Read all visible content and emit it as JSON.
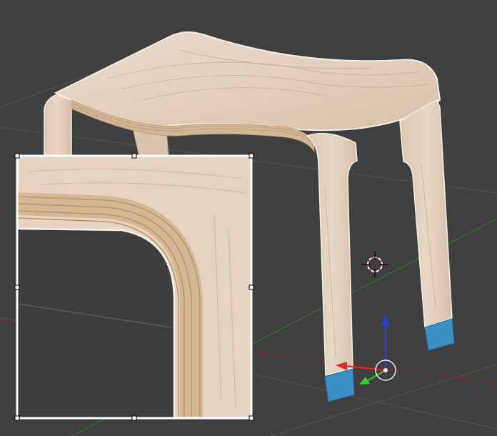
{
  "viewport": {
    "background": "#3f3f3f",
    "grid_color": "#5b5b5b",
    "x_axis_color": "#8a2323",
    "y_axis_color": "#2c7a2c"
  },
  "object": {
    "name": "stool",
    "wood_light": "#e8d6c6",
    "wood_mid": "#d9c2ad",
    "wood_edge": "#c9ae8f",
    "grain": "#b89a80",
    "foot_color": "#3a8fc4",
    "foot_dark": "#2a6f9c",
    "outline": "#f4efe9"
  },
  "gizmo": {
    "z_color": "#2a3fe0",
    "x_color": "#e02a2a",
    "y_color": "#2ad12a",
    "pivot_color": "#f0f0f0"
  },
  "cursor": {
    "ring_color": "#e04545",
    "cross_color": "#111111"
  },
  "zoom_inset": {
    "border_color": "#ffffff",
    "handle_fill": "#ffffff",
    "handle_stroke": "#000000"
  }
}
